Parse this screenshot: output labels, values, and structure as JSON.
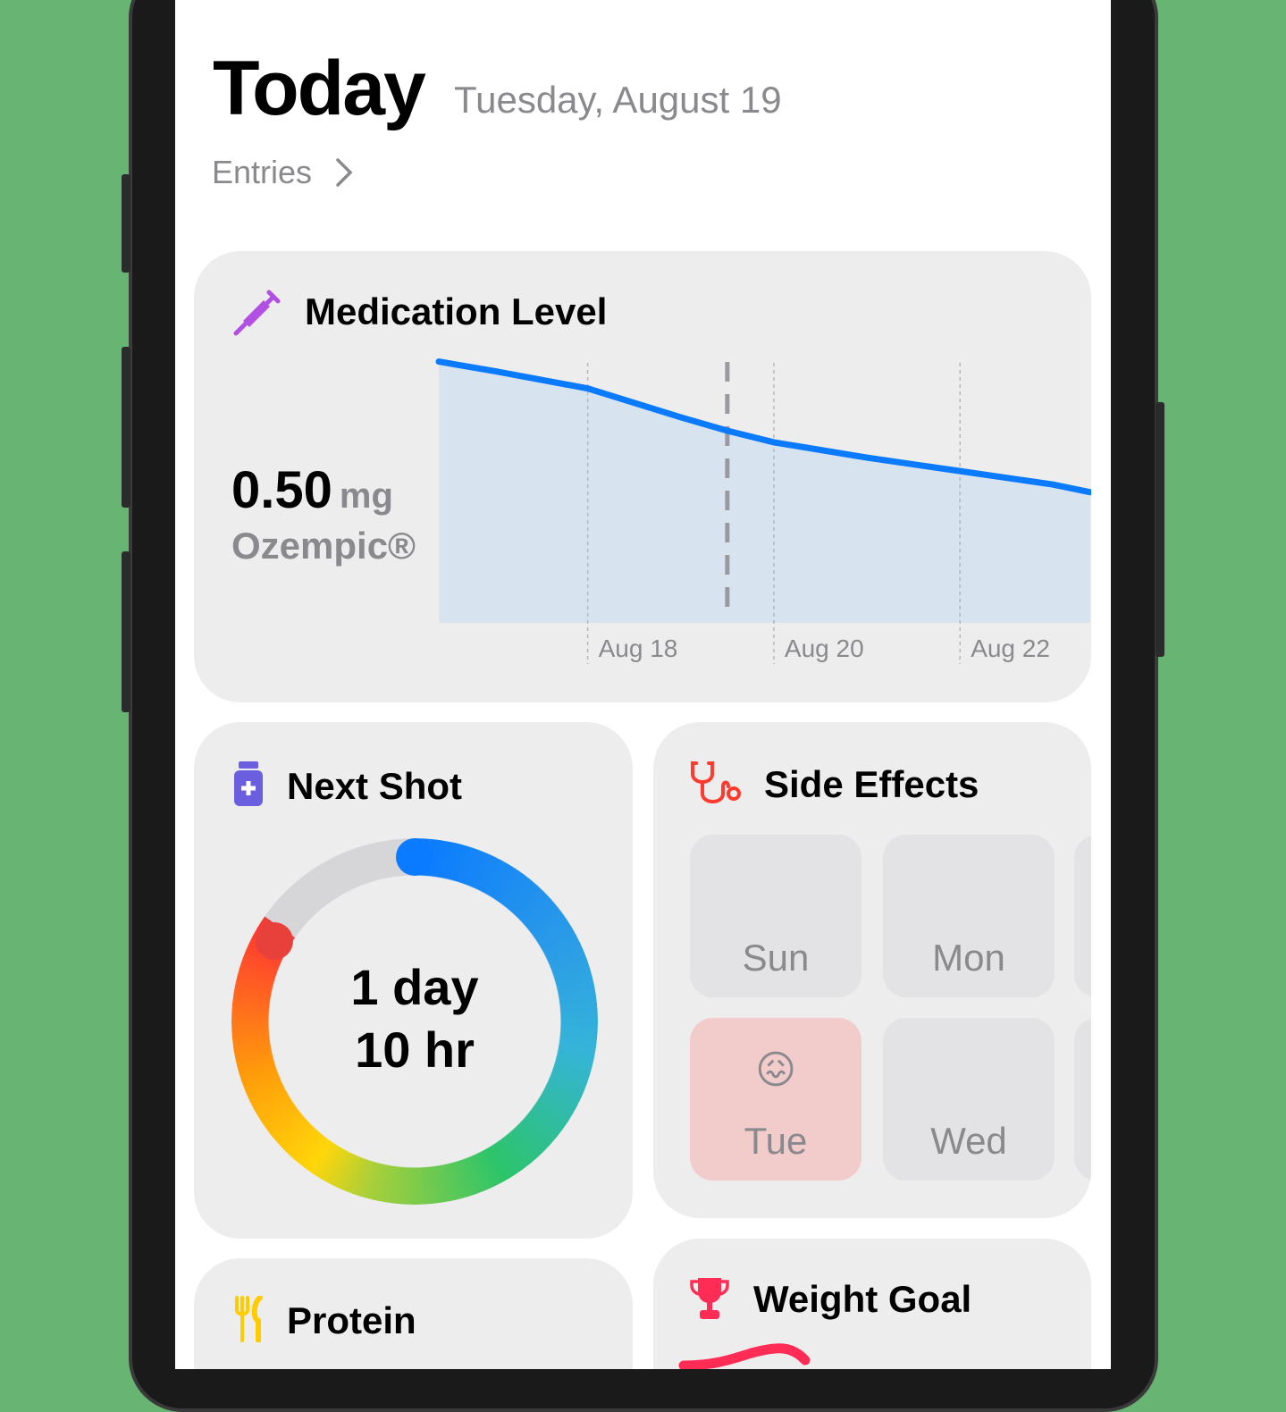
{
  "header": {
    "title": "Today",
    "date": "Tuesday, August 19",
    "entries_link": "Entries"
  },
  "medication": {
    "title": "Medication Level",
    "dose_value": "0.50",
    "dose_unit": "mg",
    "drug": "Ozempic®"
  },
  "chart_data": {
    "type": "area",
    "title": "Medication Level",
    "x_unit": "day of August",
    "x": [
      16.4,
      17,
      18,
      19,
      19.5,
      20,
      21,
      22,
      23,
      23.4
    ],
    "values": [
      0.68,
      0.655,
      0.61,
      0.535,
      0.5,
      0.47,
      0.43,
      0.395,
      0.36,
      0.34
    ],
    "today_marker": 19.5,
    "tick_labels": [
      "Aug 18",
      "Aug 20",
      "Aug 22"
    ],
    "ticks": [
      18,
      20,
      22
    ],
    "ylim": [
      0,
      1
    ],
    "xlim": [
      16.4,
      23.4
    ],
    "ylabel": "mg",
    "color": "#0a7aff",
    "fill": "#d8e3f0"
  },
  "next_shot": {
    "title": "Next Shot",
    "line1": "1 day",
    "line2": "10 hr",
    "progress": 0.85
  },
  "side_effects": {
    "title": "Side Effects",
    "days": [
      {
        "label": "Sun",
        "emoji": ""
      },
      {
        "label": "Mon",
        "emoji": ""
      },
      {
        "label": "Tue",
        "emoji": "😖",
        "highlight": "#f2cbcb"
      },
      {
        "label": "Wed",
        "emoji": ""
      }
    ]
  },
  "protein": {
    "title": "Protein"
  },
  "weight_goal": {
    "title": "Weight Goal"
  }
}
